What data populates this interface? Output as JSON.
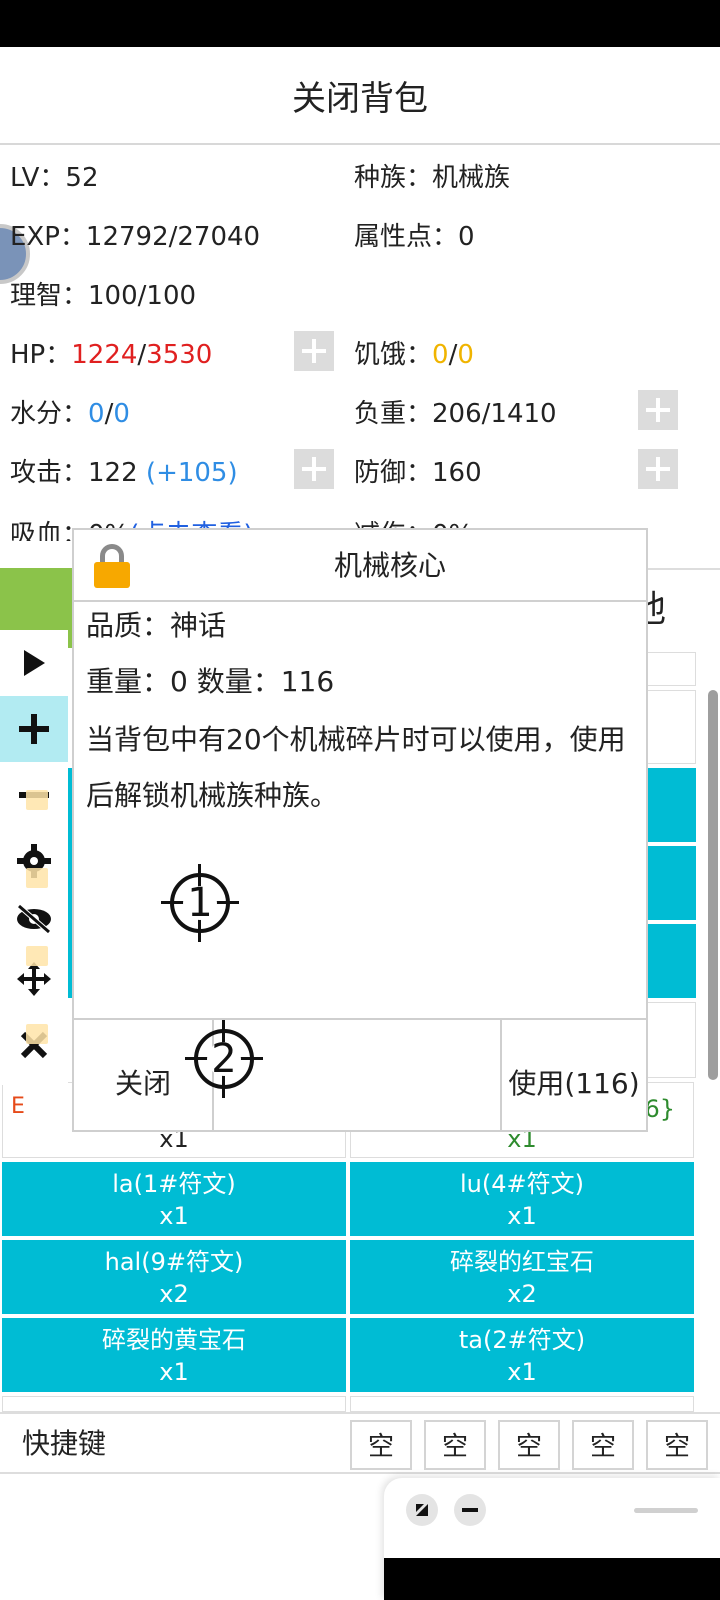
{
  "header": {
    "title": "关闭背包"
  },
  "stats": {
    "lv": {
      "label": "LV：",
      "value": "52"
    },
    "race": {
      "label": "种族：",
      "value": "机械族"
    },
    "exp": {
      "label": "EXP：",
      "value": "12792/27040"
    },
    "attr_points": {
      "label": "属性点：",
      "value": "0"
    },
    "sanity": {
      "label": "理智：",
      "value": "100/100"
    },
    "hp": {
      "label": "HP：",
      "current": "1224",
      "sep": "/",
      "max": "3530"
    },
    "hunger": {
      "label": "饥饿：",
      "current": "0",
      "sep": "/",
      "max": "0"
    },
    "water": {
      "label": "水分：",
      "current": "0",
      "sep": "/",
      "max": "0"
    },
    "load": {
      "label": "负重：",
      "value": "206/1410"
    },
    "attack": {
      "label": "攻击：",
      "value": "122",
      "bonus": "(+105)"
    },
    "defense": {
      "label": "防御：",
      "value": "160"
    },
    "lifesteal": {
      "label": "吸血：",
      "value": "0%",
      "link": "(点击查看)"
    },
    "damage_reduction": {
      "label": "减伤：",
      "value": "0%"
    }
  },
  "tabs": {
    "right_partial": "他"
  },
  "dialog": {
    "title": "机械核心",
    "quality": "品质：神话",
    "weight_count": "重量：0  数量：116",
    "description": "当背包中有20个机械碎片时可以使用，使用后解锁机械族种族。",
    "close_label": "关闭",
    "use_label": "使用(116)",
    "marker1": "1",
    "marker2": "2"
  },
  "grid": {
    "row_partial_left": {
      "tag": "E",
      "count": "x1"
    },
    "row_partial_right": {
      "suffix": "{6}",
      "count": "x1"
    },
    "items": [
      {
        "name": "la(1#符文)",
        "count": "x1"
      },
      {
        "name": "lu(4#符文)",
        "count": "x1"
      },
      {
        "name": "hal(9#符文)",
        "count": "x2"
      },
      {
        "name": "碎裂的红宝石",
        "count": "x2"
      },
      {
        "name": "碎裂的黄宝石",
        "count": "x1"
      },
      {
        "name": "ta(2#符文)",
        "count": "x1"
      }
    ]
  },
  "shortcuts": {
    "label": "快捷键",
    "slots": [
      "空",
      "空",
      "空",
      "空",
      "空"
    ]
  },
  "colors": {
    "accent_cyan": "#00bcd4",
    "tab_green": "#8bc34a",
    "hp_red": "#e02020",
    "hunger_yellow": "#f0b400",
    "bonus_blue": "#2f8de4"
  }
}
